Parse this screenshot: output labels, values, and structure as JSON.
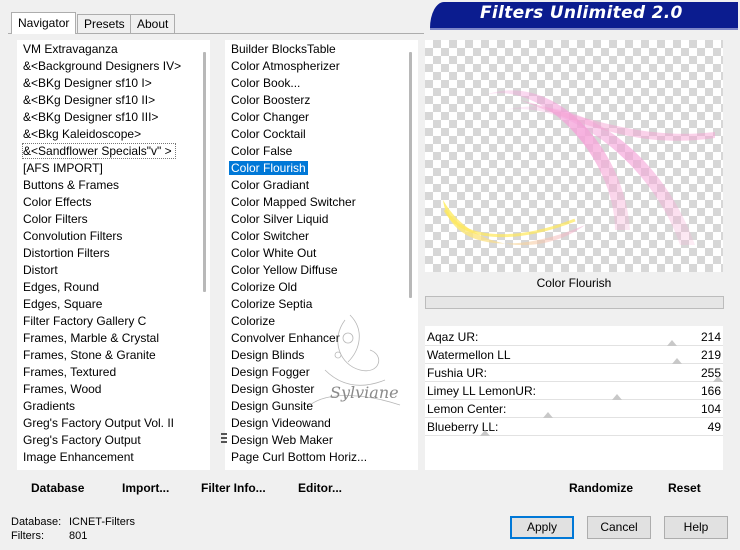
{
  "title": "Filters Unlimited 2.0",
  "tabs": [
    {
      "label": "Navigator",
      "active": true
    },
    {
      "label": "Presets",
      "active": false
    },
    {
      "label": "About",
      "active": false
    }
  ],
  "categories": [
    "VM Extravaganza",
    "&<Background Designers IV>",
    "&<BKg Designer sf10 I>",
    "&<BKg Designer sf10 II>",
    "&<BKg Designer sf10 III>",
    "&<Bkg Kaleidoscope>",
    "&<Sandflower Specials\"v\" >",
    "[AFS IMPORT]",
    "Buttons & Frames",
    "Color Effects",
    "Color Filters",
    "Convolution Filters",
    "Distortion Filters",
    "Distort",
    "Edges, Round",
    "Edges, Square",
    "Filter Factory Gallery C",
    "Frames, Marble & Crystal",
    "Frames, Stone & Granite",
    "Frames, Textured",
    "Frames, Wood",
    "Gradients",
    "Greg's Factory Output Vol. II",
    "Greg's Factory Output",
    "Image Enhancement"
  ],
  "selected_category": "&<Sandflower Specials\"v\" >",
  "filters": [
    "Builder BlocksTable",
    "Color Atmospherizer",
    "Color Book...",
    "Color Boosterz",
    "Color Changer",
    "Color Cocktail",
    "Color False",
    "Color Flourish",
    "Color Gradiant",
    "Color Mapped Switcher",
    "Color Silver Liquid",
    "Color Switcher",
    "Color White Out",
    "Color Yellow Diffuse",
    "Colorize Old",
    "Colorize Septia",
    "Colorize",
    "Convolver Enhancer",
    "Design Blinds",
    "Design Fogger",
    "Design Ghoster",
    "Design Gunsite",
    "Design Videowand",
    "Design Web Maker",
    "Page Curl Bottom Horiz..."
  ],
  "selected_filter": "Color Flourish",
  "preview": {
    "filter_name": "Color Flourish"
  },
  "params": [
    {
      "label": "Aqaz UR:",
      "value": 214,
      "fraction": 0.839
    },
    {
      "label": "Watermellon LL",
      "value": 219,
      "fraction": 0.859
    },
    {
      "label": "Fushia UR:",
      "value": 255,
      "fraction": 1.0
    },
    {
      "label": "Limey LL LemonUR:",
      "value": 166,
      "fraction": 0.651
    },
    {
      "label": "Lemon Center:",
      "value": 104,
      "fraction": 0.408
    },
    {
      "label": "Blueberry LL:",
      "value": 49,
      "fraction": 0.192
    }
  ],
  "toolbar": {
    "database": "Database",
    "import": "Import...",
    "filter_info": "Filter Info...",
    "editor": "Editor...",
    "randomize": "Randomize",
    "reset": "Reset"
  },
  "status": {
    "database_label": "Database:",
    "database_value": "ICNET-Filters",
    "filters_label": "Filters:",
    "filters_value": "801"
  },
  "buttons": {
    "apply": "Apply",
    "cancel": "Cancel",
    "help": "Help"
  },
  "watermark": "Sylviane",
  "colors": {
    "banner": "#0b1c8f",
    "selection": "#0078d7"
  }
}
